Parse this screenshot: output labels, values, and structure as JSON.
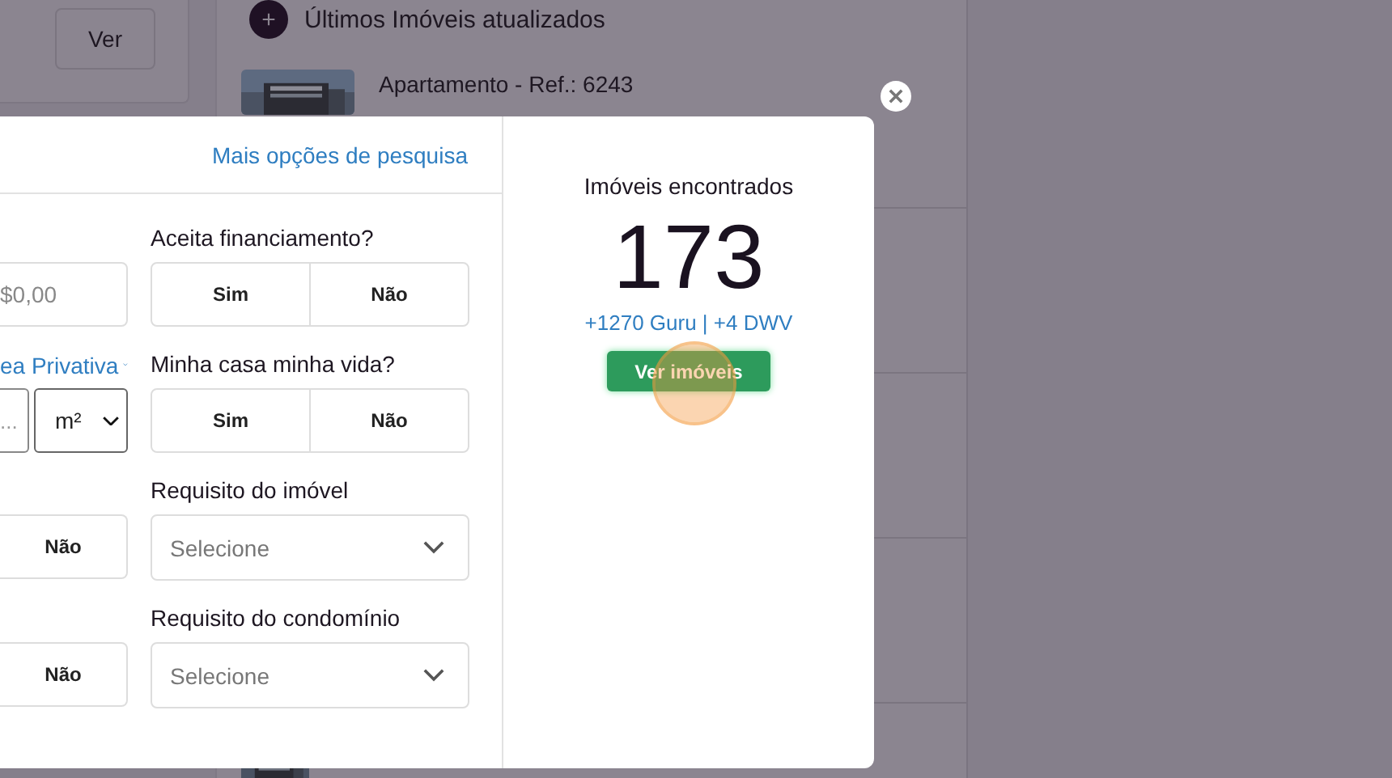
{
  "background": {
    "side_button": "Ver",
    "list_title_icon": "+",
    "list_title": "Últimos Imóveis atualizados",
    "listings": [
      {
        "title": "Apartamento - Ref.: 6243"
      }
    ]
  },
  "modal": {
    "link": "Mais opções de pesquisa",
    "rows": [
      {
        "left": {
          "kind": "input",
          "placeholder": "$0,00"
        },
        "right": {
          "kind": "toggle",
          "label": "Aceita financiamento?",
          "options": [
            {
              "label": "Sim",
              "selected": false
            },
            {
              "label": "Não",
              "selected": false
            }
          ]
        }
      },
      {
        "left": {
          "kind": "area",
          "label": "ea Privativa",
          "placeholder": "...",
          "unit": "m²"
        },
        "right": {
          "kind": "toggle",
          "label": "Minha casa minha vida?",
          "options": [
            {
              "label": "Sim",
              "selected": false
            },
            {
              "label": "Não",
              "selected": false
            }
          ]
        }
      },
      {
        "left": {
          "kind": "toggle",
          "options": [
            {
              "label": "Não",
              "selected": false
            }
          ]
        },
        "right": {
          "kind": "select",
          "label": "Requisito do imóvel",
          "placeholder": "Selecione"
        }
      },
      {
        "left": {
          "kind": "toggle",
          "options": [
            {
              "label": "Não",
              "selected": false
            }
          ]
        },
        "right": {
          "kind": "select",
          "label": "Requisito do condomínio",
          "placeholder": "Selecione"
        }
      }
    ],
    "results": {
      "title": "Imóveis encontrados",
      "count": "173",
      "sources": "+1270 Guru | +4 DWV",
      "button": "Ver imóveis"
    }
  }
}
